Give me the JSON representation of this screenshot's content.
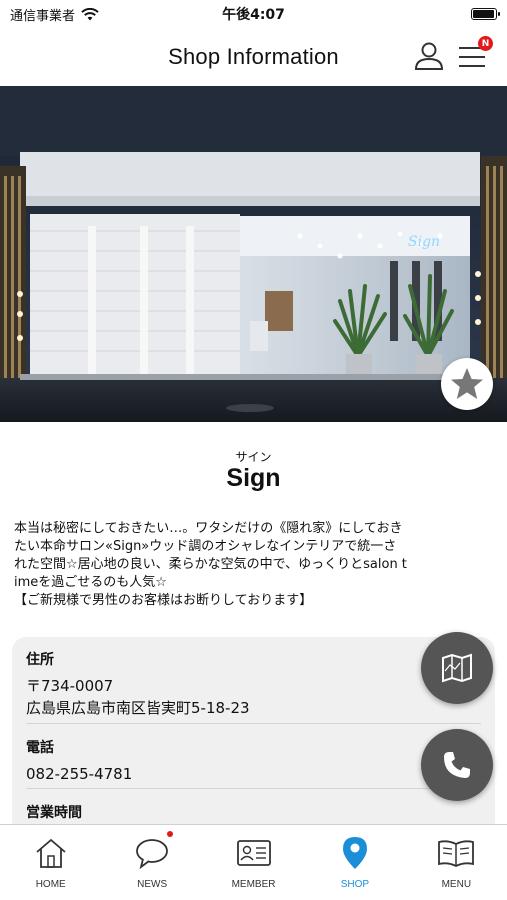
{
  "status_bar": {
    "carrier": "通信事業者",
    "time": "午後4:07",
    "battery_level": 0.95
  },
  "header": {
    "title": "Shop Information",
    "menu_badge": "N"
  },
  "shop": {
    "kana": "サイン",
    "name": "Sign",
    "description": [
      "本当は秘密にしておきたい…。ワタシだけの《隠れ家》にしておき",
      "たい本命サロン«Sign»ウッド調のオシャレなインテリアで統一さ",
      "れた空間☆居心地の良い、柔らかな空気の中で、ゆっくりとsalon t",
      "imeを過ごせるのも人気☆",
      "【ご新規様で男性のお客様はお断りしております】"
    ],
    "neon_sign": "Sign"
  },
  "info": {
    "address_label": "住所",
    "postal_code": "〒734-0007",
    "address": "広島県広島市南区皆実町5-18-23",
    "phone_label": "電話",
    "phone": "082-255-4781",
    "hours_label": "営業時間"
  },
  "tabs": [
    {
      "label": "HOME",
      "icon": "home-icon",
      "active": false
    },
    {
      "label": "NEWS",
      "icon": "chat-bubble-icon",
      "active": false
    },
    {
      "label": "MEMBER",
      "icon": "member-card-icon",
      "active": false
    },
    {
      "label": "SHOP",
      "icon": "map-pin-icon",
      "active": true
    },
    {
      "label": "MENU",
      "icon": "book-icon",
      "active": false
    }
  ],
  "colors": {
    "accent": "#1a8fd8",
    "badge": "#e21a1a",
    "fab": "#555555",
    "card_bg": "#f0f0f0"
  }
}
